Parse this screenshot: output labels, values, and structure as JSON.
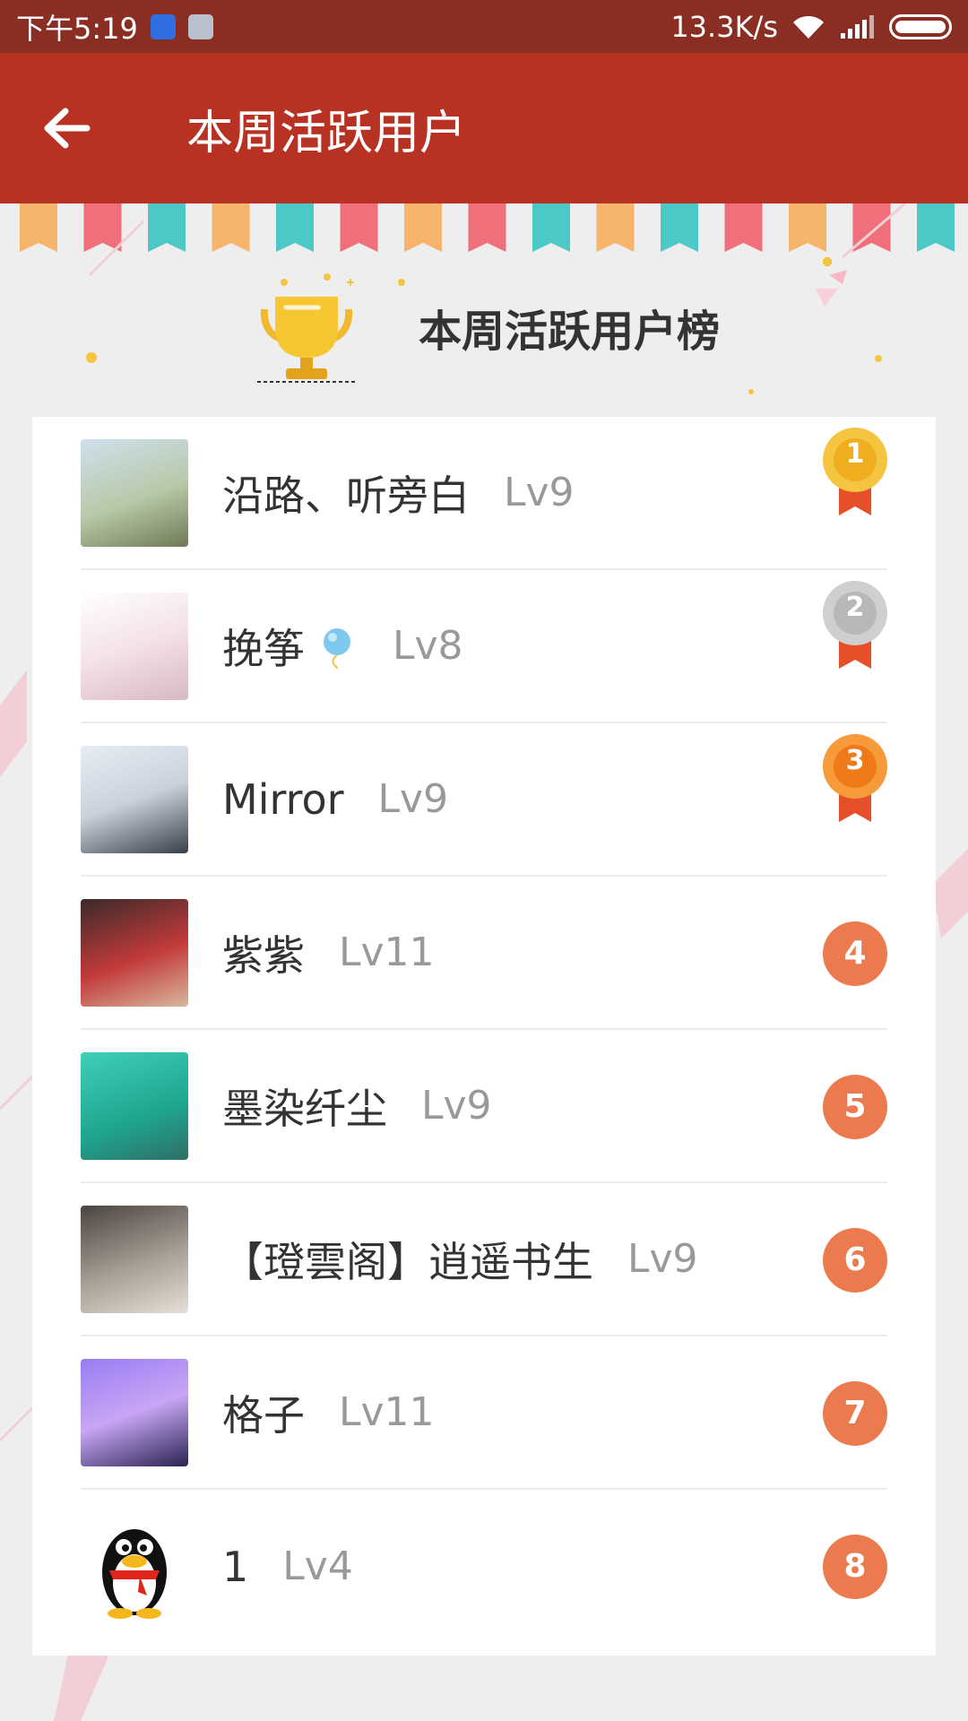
{
  "status_bar": {
    "time": "下午5:19",
    "network_speed": "13.3K/s"
  },
  "app_bar": {
    "back_icon": "arrow-left-icon",
    "title": "本周活跃用户"
  },
  "header": {
    "trophy_icon": "trophy-icon",
    "title": "本周活跃用户榜"
  },
  "colors": {
    "status_bar": "#8a2e24",
    "app_bar": "#b83223",
    "rank_badge": "#ec7a4f",
    "gold": "#f2b82f",
    "silver": "#bdbdbd",
    "bronze": "#f28a2a",
    "ribbon": "#e5502a"
  },
  "users": [
    {
      "name": "沿路、听旁白",
      "level": "Lv9",
      "rank": "1",
      "badge": "gold-medal-icon"
    },
    {
      "name": "挽筝",
      "level": "Lv8",
      "rank": "2",
      "badge": "silver-medal-icon"
    },
    {
      "name": "Mirror",
      "level": "Lv9",
      "rank": "3",
      "badge": "bronze-medal-icon"
    },
    {
      "name": "紫紫",
      "level": "Lv11",
      "rank": "4",
      "badge": "rank-circle"
    },
    {
      "name": "墨染纤尘",
      "level": "Lv9",
      "rank": "5",
      "badge": "rank-circle"
    },
    {
      "name": "【璒雲阁】逍遥书生",
      "level": "Lv9",
      "rank": "6",
      "badge": "rank-circle"
    },
    {
      "name": "格子",
      "level": "Lv11",
      "rank": "7",
      "badge": "rank-circle"
    },
    {
      "name": "1",
      "level": "Lv4",
      "rank": "8",
      "badge": "rank-circle"
    }
  ]
}
